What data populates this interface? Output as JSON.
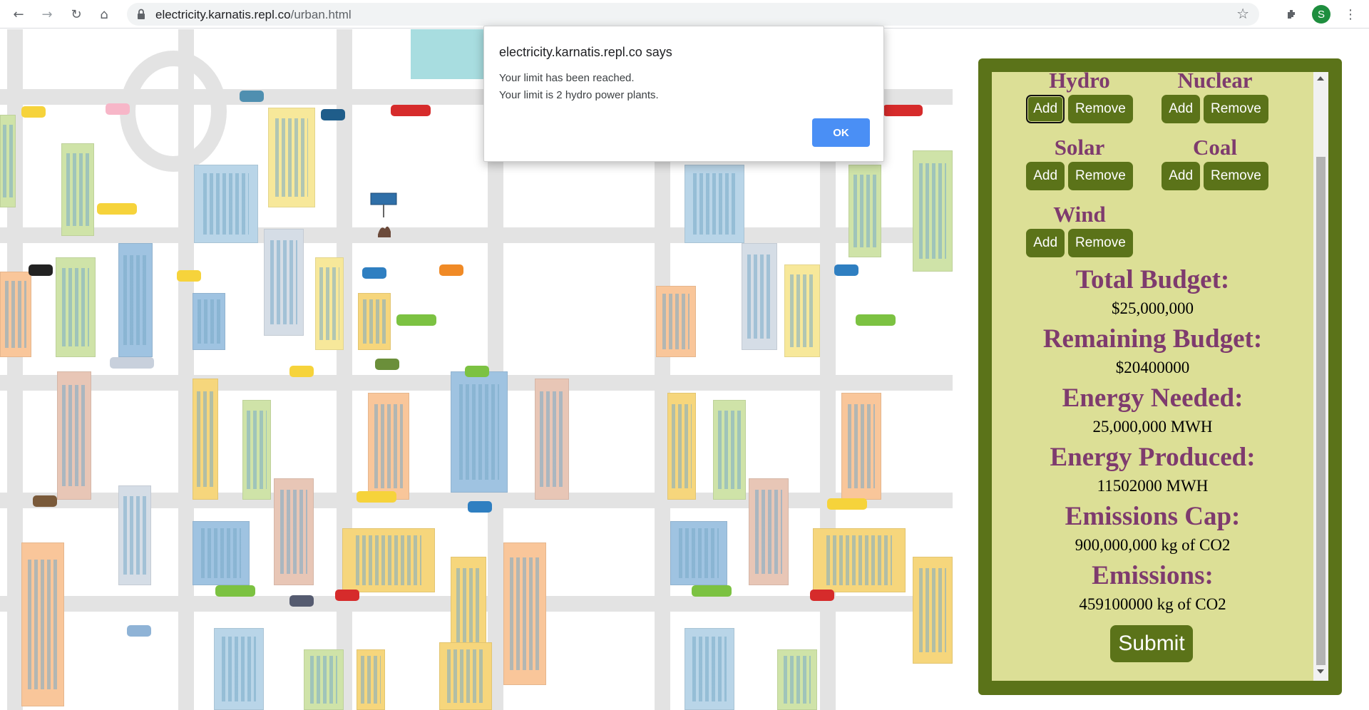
{
  "browser": {
    "url_domain": "electricity.karnatis.repl.co",
    "url_path": "/urban.html",
    "profile_initial": "S",
    "icons": [
      "back-icon",
      "forward-icon",
      "reload-icon",
      "home-icon",
      "lock-icon",
      "star-icon",
      "extensions-icon",
      "menu-icon"
    ]
  },
  "dialog": {
    "title": "electricity.karnatis.repl.co says",
    "line1": "Your limit has been reached.",
    "line2": "Your limit is 2 hydro power plants.",
    "ok_label": "OK"
  },
  "plants": [
    {
      "name": "Hydro",
      "add": "Add",
      "remove": "Remove"
    },
    {
      "name": "Nuclear",
      "add": "Add",
      "remove": "Remove"
    },
    {
      "name": "Solar",
      "add": "Add",
      "remove": "Remove"
    },
    {
      "name": "Coal",
      "add": "Add",
      "remove": "Remove"
    },
    {
      "name": "Wind",
      "add": "Add",
      "remove": "Remove"
    }
  ],
  "stats": {
    "total_budget_label": "Total Budget:",
    "total_budget_value": "$25,000,000",
    "remaining_budget_label": "Remaining Budget:",
    "remaining_budget_value": "$20400000",
    "energy_needed_label": "Energy Needed:",
    "energy_needed_value": "25,000,000 MWH",
    "energy_produced_label": "Energy Produced:",
    "energy_produced_value": "11502000 MWH",
    "emissions_cap_label": "Emissions Cap:",
    "emissions_cap_value": "900,000,000 kg of CO2",
    "emissions_label": "Emissions:",
    "emissions_value": "459100000 kg of CO2"
  },
  "submit_label": "Submit",
  "colors": {
    "panel_frame": "#5b7319",
    "panel_bg": "#dcdf96",
    "heading": "#7e3b6e",
    "button": "#5b7319",
    "dialog_ok": "#4a8ff5"
  }
}
